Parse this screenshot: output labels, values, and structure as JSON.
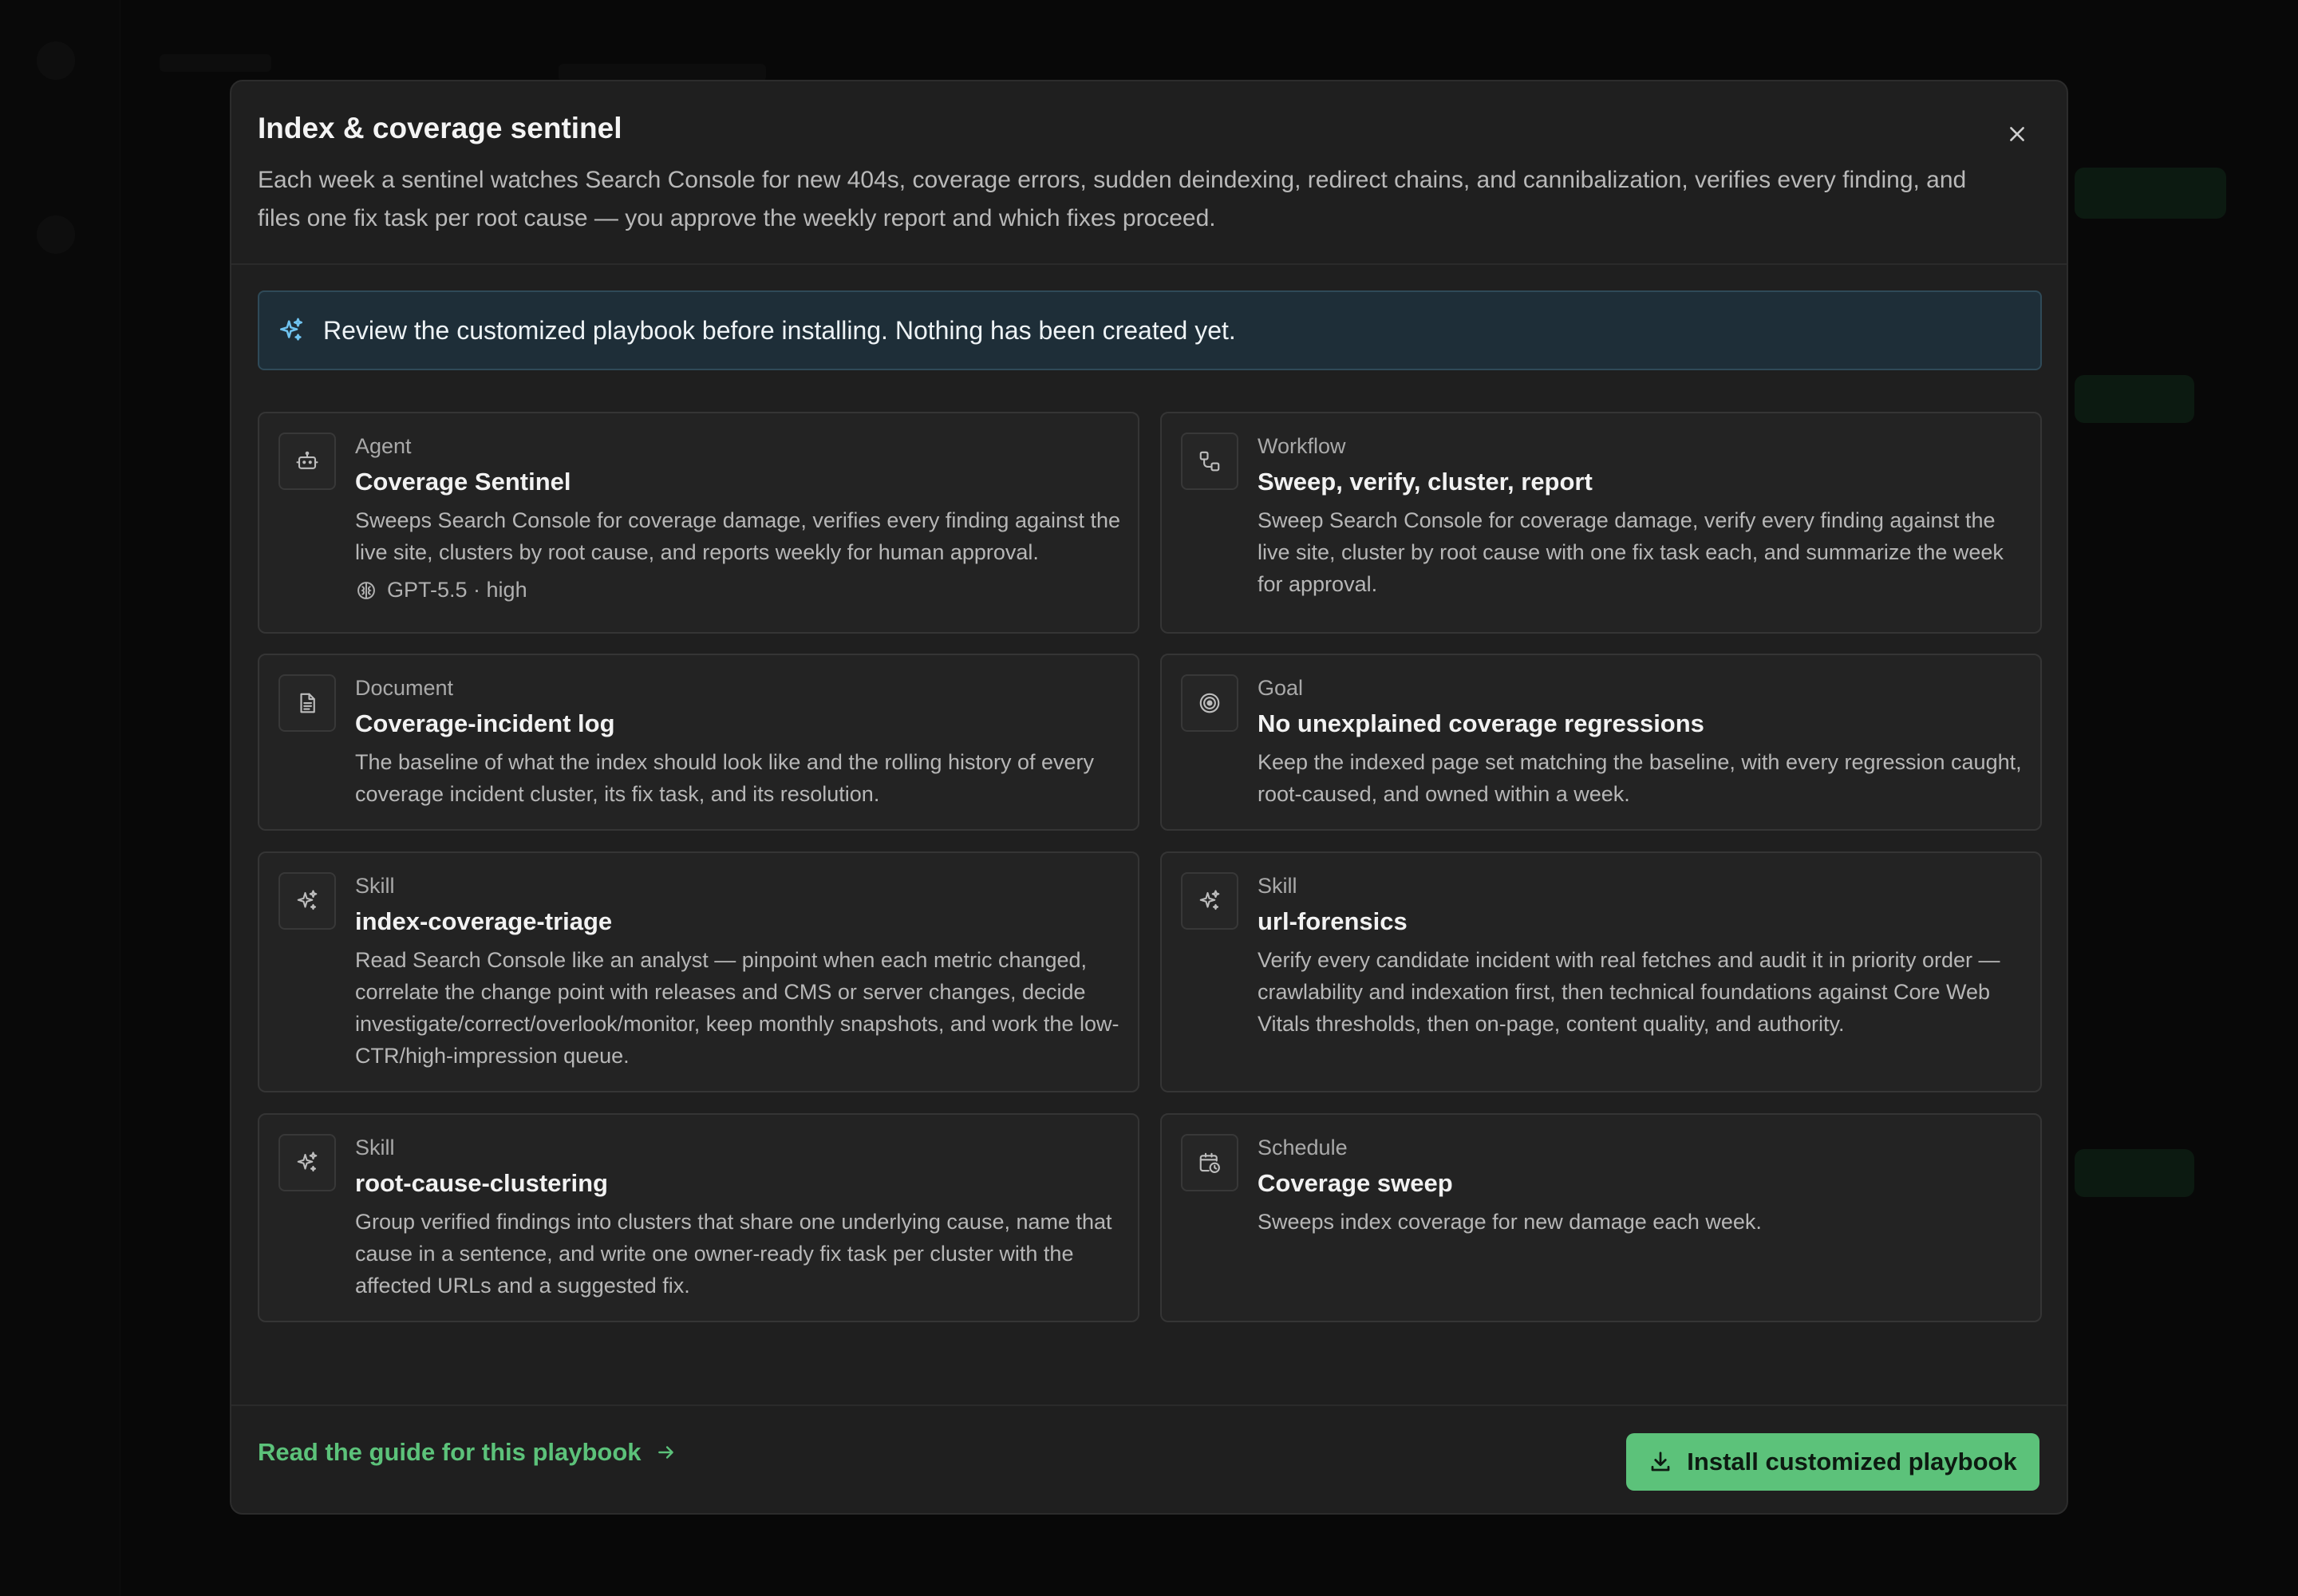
{
  "modal": {
    "title": "Index & coverage sentinel",
    "description": "Each week a sentinel watches Search Console for new 404s, coverage errors, sudden deindexing, redirect chains, and cannibalization, verifies every finding, and files one fix task per root cause — you approve the weekly report and which fixes proceed.",
    "close_icon": "close-icon"
  },
  "notice": {
    "icon": "sparkles-icon",
    "text": "Review the customized playbook before installing. Nothing has been created yet."
  },
  "cards": [
    {
      "type": "Agent",
      "title": "Coverage Sentinel",
      "description": "Sweeps Search Console for coverage damage, verifies every finding against the live site, clusters by root cause, and reports weekly for human approval.",
      "meta": "GPT-5.5 · high",
      "icon": "robot-icon",
      "meta_icon": "brain-icon"
    },
    {
      "type": "Workflow",
      "title": "Sweep, verify, cluster, report",
      "description": "Sweep Search Console for coverage damage, verify every finding against the live site, cluster by root cause with one fix task each, and summarize the week for approval.",
      "icon": "workflow-icon"
    },
    {
      "type": "Document",
      "title": "Coverage-incident log",
      "description": "The baseline of what the index should look like and the rolling history of every coverage incident cluster, its fix task, and its resolution.",
      "icon": "document-icon"
    },
    {
      "type": "Goal",
      "title": "No unexplained coverage regressions",
      "description": "Keep the indexed page set matching the baseline, with every regression caught, root-caused, and owned within a week.",
      "icon": "target-icon"
    },
    {
      "type": "Skill",
      "title": "index-coverage-triage",
      "description": "Read Search Console like an analyst — pinpoint when each metric changed, correlate the change point with releases and CMS or server changes, decide investigate/correct/overlook/monitor, keep monthly snapshots, and work the low-CTR/high-impression queue.",
      "icon": "sparkles-icon"
    },
    {
      "type": "Skill",
      "title": "url-forensics",
      "description": "Verify every candidate incident with real fetches and audit it in priority order — crawlability and indexation first, then technical foundations against Core Web Vitals thresholds, then on-page, content quality, and authority.",
      "icon": "sparkles-icon"
    },
    {
      "type": "Skill",
      "title": "root-cause-clustering",
      "description": "Group verified findings into clusters that share one underlying cause, name that cause in a sentence, and write one owner-ready fix task per cluster with the affected URLs and a suggested fix.",
      "icon": "sparkles-icon"
    },
    {
      "type": "Schedule",
      "title": "Coverage sweep",
      "description": "Sweeps index coverage for new damage each week.",
      "icon": "calendar-clock-icon"
    }
  ],
  "guide_link": {
    "label": "Read the guide for this playbook",
    "icon": "arrow-right-icon"
  },
  "install_button": {
    "label": "Install customized playbook",
    "icon": "download-icon"
  },
  "colors": {
    "accent": "#5cc27a",
    "notice_bg": "#1e2e38",
    "modal_bg": "#1f1f1f"
  }
}
